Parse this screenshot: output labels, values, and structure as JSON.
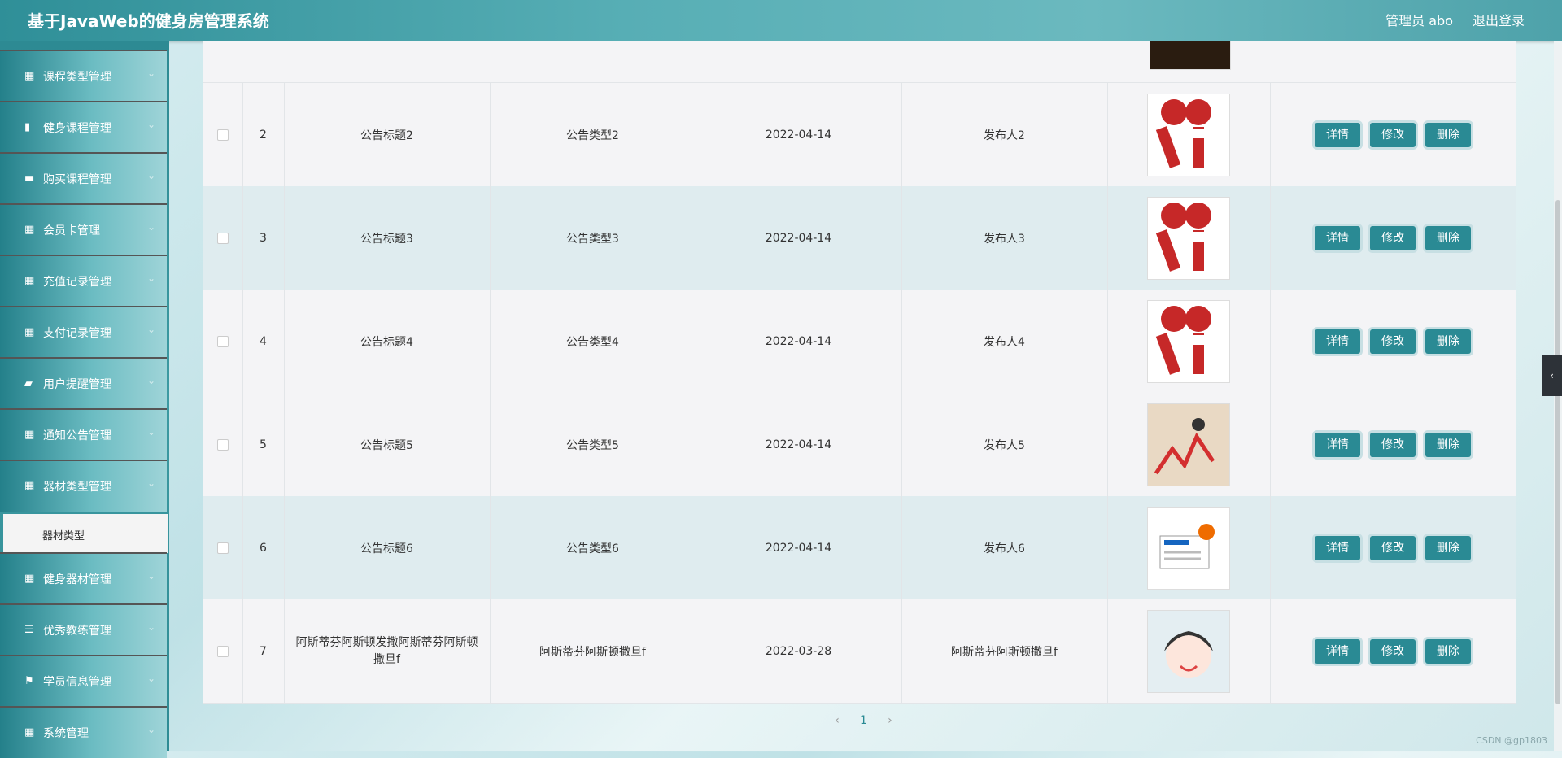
{
  "app": {
    "title": "基于JavaWeb的健身房管理系统",
    "user": "管理员 abo",
    "logout": "退出登录"
  },
  "sidebar": {
    "items": [
      {
        "label": "课程类型管理",
        "icon": "grid-icon"
      },
      {
        "label": "健身课程管理",
        "icon": "bar-chart-icon"
      },
      {
        "label": "购买课程管理",
        "icon": "cart-icon"
      },
      {
        "label": "会员卡管理",
        "icon": "grid-icon"
      },
      {
        "label": "充值记录管理",
        "icon": "grid-icon"
      },
      {
        "label": "支付记录管理",
        "icon": "grid-icon"
      },
      {
        "label": "用户提醒管理",
        "icon": "message-icon"
      },
      {
        "label": "通知公告管理",
        "icon": "grid-icon"
      },
      {
        "label": "器材类型管理",
        "icon": "grid-icon"
      },
      {
        "label": "健身器材管理",
        "icon": "grid-icon"
      },
      {
        "label": "优秀教练管理",
        "icon": "list-icon"
      },
      {
        "label": "学员信息管理",
        "icon": "flag-icon"
      },
      {
        "label": "系统管理",
        "icon": "grid-icon"
      }
    ],
    "submenu_item": "器材类型"
  },
  "table": {
    "actions": {
      "detail": "详情",
      "edit": "修改",
      "delete": "删除"
    },
    "rows": [
      {
        "id": "2",
        "title": "公告标题2",
        "type": "公告类型2",
        "date": "2022-04-14",
        "publisher": "发布人2",
        "image": "microphone-news-icon"
      },
      {
        "id": "3",
        "title": "公告标题3",
        "type": "公告类型3",
        "date": "2022-04-14",
        "publisher": "发布人3",
        "image": "microphone-news-icon"
      },
      {
        "id": "4",
        "title": "公告标题4",
        "type": "公告类型4",
        "date": "2022-04-14",
        "publisher": "发布人4",
        "image": "microphone-news-icon"
      },
      {
        "id": "5",
        "title": "公告标题5",
        "type": "公告类型5",
        "date": "2022-04-14",
        "publisher": "发布人5",
        "image": "chart-crash-icon"
      },
      {
        "id": "6",
        "title": "公告标题6",
        "type": "公告类型6",
        "date": "2022-04-14",
        "publisher": "发布人6",
        "image": "newspaper-icon"
      },
      {
        "id": "7",
        "title": "阿斯蒂芬阿斯顿发撒阿斯蒂芬阿斯顿撒旦f",
        "type": "阿斯蒂芬阿斯顿撒旦f",
        "date": "2022-03-28",
        "publisher": "阿斯蒂芬阿斯顿撒旦f",
        "image": "anime-girl-avatar"
      }
    ]
  },
  "pagination": {
    "prev": "‹",
    "current": "1",
    "next": "›"
  },
  "watermark": "CSDN @gp1803"
}
